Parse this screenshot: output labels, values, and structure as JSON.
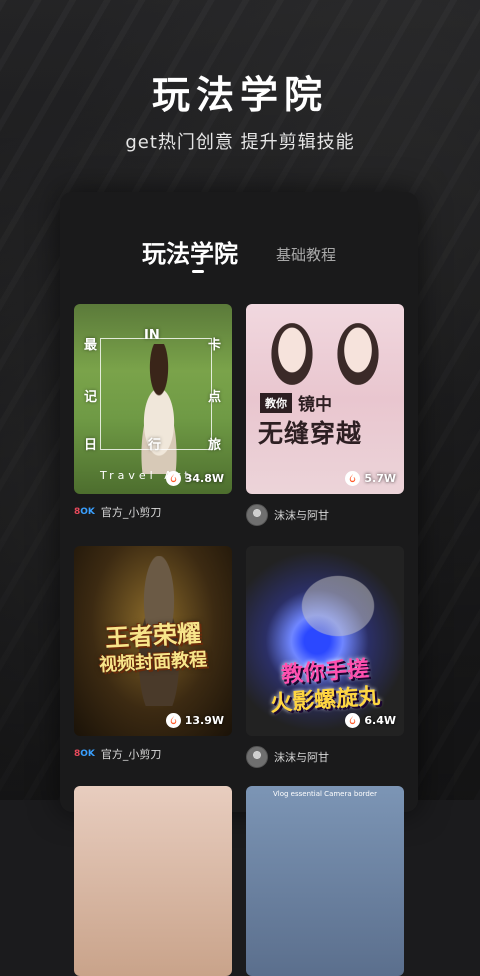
{
  "hero": {
    "title": "玩法学院",
    "subtitle": "get热门创意 提升剪辑技能"
  },
  "tabs": [
    {
      "label": "玩法学院",
      "active": true
    },
    {
      "label": "基础教程",
      "active": false
    }
  ],
  "cards": [
    {
      "views": "34.8W",
      "author": "官方_小剪刀",
      "thumb_text": [
        "最",
        "IN",
        "卡",
        "记",
        "点",
        "日",
        "行",
        "旅"
      ],
      "thumb_caption": "Travel Art"
    },
    {
      "views": "5.7W",
      "author": "沫沫与阿甘",
      "tag": "教你",
      "line1": "镜中",
      "line2": "无缝穿越"
    },
    {
      "views": "13.9W",
      "author": "官方_小剪刀",
      "line1": "王者荣耀",
      "line2": "视频封面教程"
    },
    {
      "views": "6.4W",
      "author": "沫沫与阿甘",
      "line1": "教你手搓",
      "line2": "火影螺旋丸"
    },
    {
      "views": "",
      "author": "",
      "caption": ""
    },
    {
      "views": "",
      "author": "",
      "caption": "Vlog essential Camera border"
    }
  ],
  "brand_logo": "8OK",
  "colors": {
    "background": "#1b1b1d",
    "panel": "#1a1a1b",
    "text_primary": "#ffffff",
    "text_secondary": "#a8a8a8",
    "fire_icon": "#ff5a2a"
  }
}
